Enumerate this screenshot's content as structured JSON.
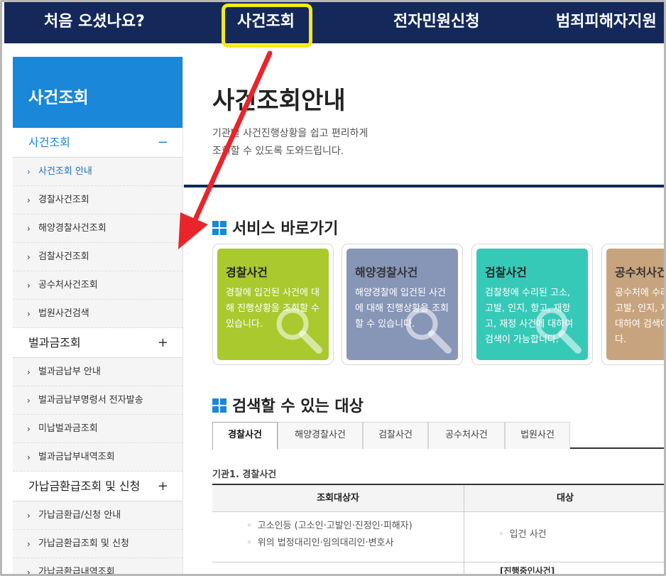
{
  "topnav": {
    "items": [
      "처음 오셨나요?",
      "사건조회",
      "전자민원신청",
      "범죄피해자지원"
    ]
  },
  "sidebar": {
    "title": "사건조회",
    "groups": [
      {
        "label": "사건조회",
        "sign": "−",
        "items": [
          "사건조회 안내",
          "경찰사건조회",
          "해양경찰사건조회",
          "검찰사건조회",
          "공수처사건조회",
          "법원사건검색"
        ]
      },
      {
        "label": "벌과금조회",
        "sign": "+",
        "items": [
          "벌과금납부 안내",
          "벌과금납부명령서 전자발송",
          "미납벌과금조회",
          "벌과금납부내역조회"
        ]
      },
      {
        "label": "가납금환급조회 및 신청",
        "sign": "+",
        "items": [
          "가납금환급/신청 안내",
          "가납금환급조회 및 신청",
          "가납금환급내역조회"
        ]
      }
    ]
  },
  "main": {
    "title": "사건조회안내",
    "desc_line1": "기관별 사건진행상황을 쉽고 편리하게",
    "desc_line2": "조회할 수 있도록 도와드립니다.",
    "services_title": "서비스 바로가기",
    "cards": [
      {
        "title": "경찰사건",
        "desc": "경찰에 입건된 사건에 대해 진행상황을 조회할 수 있습니다."
      },
      {
        "title": "해양경찰사건",
        "desc": "해양경찰에 입건된 사건에 대해 진행상황을 조회할 수 있습니다."
      },
      {
        "title": "검찰사건",
        "desc": "검찰청에 수리된 고소, 고발, 인지, 항고, 재항고, 재정 사건에 대하여 검색이 가능합니다."
      },
      {
        "title": "공수처사건",
        "desc": "공수처에 수리된 고소, 고발, 인지, 재정 사건에 대하여 검색이 가능합니다."
      }
    ],
    "targets_title": "검색할 수 있는 대상",
    "tabs": [
      "경찰사건",
      "해양경찰사건",
      "검찰사건",
      "공수처사건",
      "법원사건"
    ],
    "org_label": "기관1. 경찰사건",
    "table": {
      "col1": "조회대상자",
      "col2": "대상",
      "row1_col1": [
        "고소인등 (고소인·고발인·진정인·피해자)",
        "위의 법정대리인·임의대리인·변호사"
      ],
      "row1_col2": [
        "입건 사건"
      ],
      "row2_col2": "[진행중인사건]"
    }
  },
  "colors": {
    "nav_bg": "#14295a",
    "highlight": "#f6e81a",
    "sidebar_head": "#1a87d9",
    "arrow": "#e8252a",
    "card_police": "#a9c92f",
    "card_coast": "#8795b7",
    "card_prosecutor": "#37c9b7",
    "card_cio": "#c8a47e"
  }
}
